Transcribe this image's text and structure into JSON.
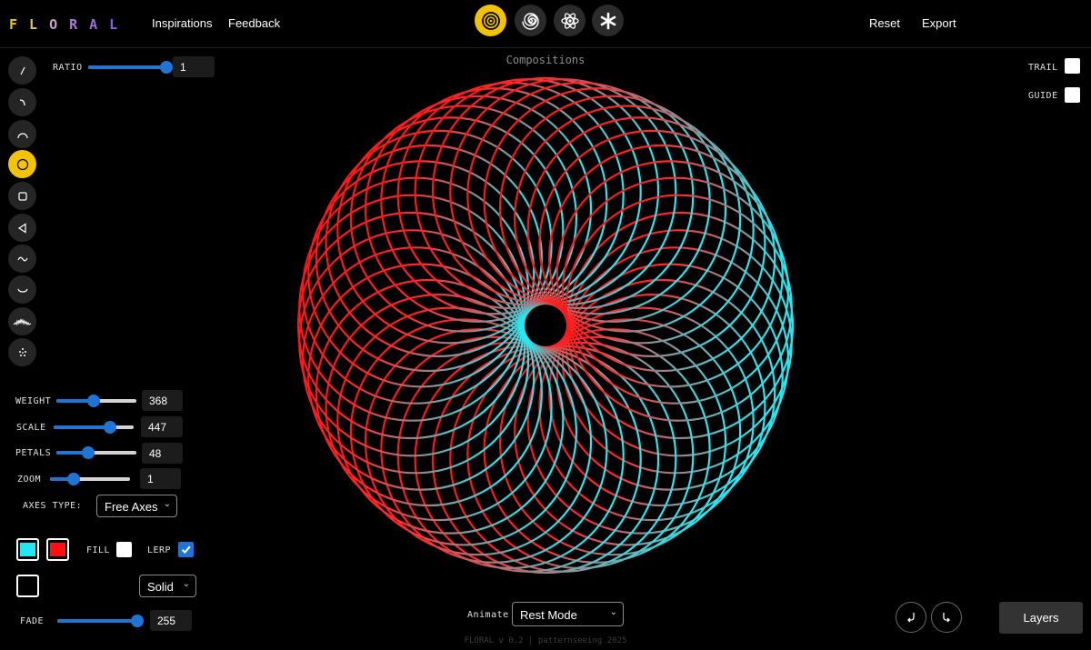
{
  "header": {
    "logo_letters": [
      "F",
      "L",
      "O",
      "R",
      "A",
      "L"
    ],
    "logo_colors": [
      "#f3c300",
      "#e6c35a",
      "#c9a0c8",
      "#b07ad6",
      "#9a6ce0",
      "#8a5fe6"
    ],
    "nav": {
      "inspirations": "Inspirations",
      "feedback": "Feedback",
      "reset": "Reset",
      "export": "Export"
    },
    "modes": [
      {
        "icon": "concentric-circles-icon",
        "active": true
      },
      {
        "icon": "spiral-icon",
        "active": false
      },
      {
        "icon": "atom-icon",
        "active": false
      },
      {
        "icon": "asterisk-icon",
        "active": false
      }
    ]
  },
  "tools": [
    {
      "icon": "line-icon",
      "active": false
    },
    {
      "icon": "curve-icon",
      "active": false
    },
    {
      "icon": "arc-icon",
      "active": false
    },
    {
      "icon": "circle-icon",
      "active": true
    },
    {
      "icon": "square-icon",
      "active": false
    },
    {
      "icon": "triangle-icon",
      "active": false
    },
    {
      "icon": "sine-wave-icon",
      "active": false
    },
    {
      "icon": "dip-curve-icon",
      "active": false
    },
    {
      "icon": "noise-wave-icon",
      "active": false
    },
    {
      "icon": "sparkle-icon",
      "active": false
    }
  ],
  "controls": {
    "ratio": {
      "label": "RATIO",
      "value": "1",
      "fraction": 1.0
    },
    "weight": {
      "label": "WEIGHT",
      "value": "368",
      "fraction": 0.47
    },
    "scale": {
      "label": "SCALE",
      "value": "447",
      "fraction": 0.71
    },
    "petals": {
      "label": "PETALS",
      "value": "48",
      "fraction": 0.4
    },
    "zoom": {
      "label": "ZOOM",
      "value": "1",
      "fraction": 0.3
    },
    "axes_type": {
      "label": "AXES TYPE:",
      "selected": "Free Axes"
    },
    "color_a": "#28e6f0",
    "color_b": "#ff1010",
    "fill": {
      "label": "FILL",
      "checked": false
    },
    "lerp": {
      "label": "LERP",
      "checked": true
    },
    "stroke_style": {
      "selected": "Solid"
    },
    "fade": {
      "label": "FADE",
      "value": "255",
      "fraction": 1.0
    }
  },
  "canvas": {
    "title": "Compositions",
    "trail": {
      "label": "TRAIL",
      "checked": false
    },
    "guide": {
      "label": "GUIDE",
      "checked": false
    },
    "petals": 48,
    "stroke_from": "#ff1010",
    "stroke_to": "#28e6f0"
  },
  "bottom": {
    "animate_label": "Animate",
    "animate_selected": "Rest Mode",
    "layers": "Layers",
    "footer": "FLORAL v 0.2 | patternseeing 2025"
  }
}
